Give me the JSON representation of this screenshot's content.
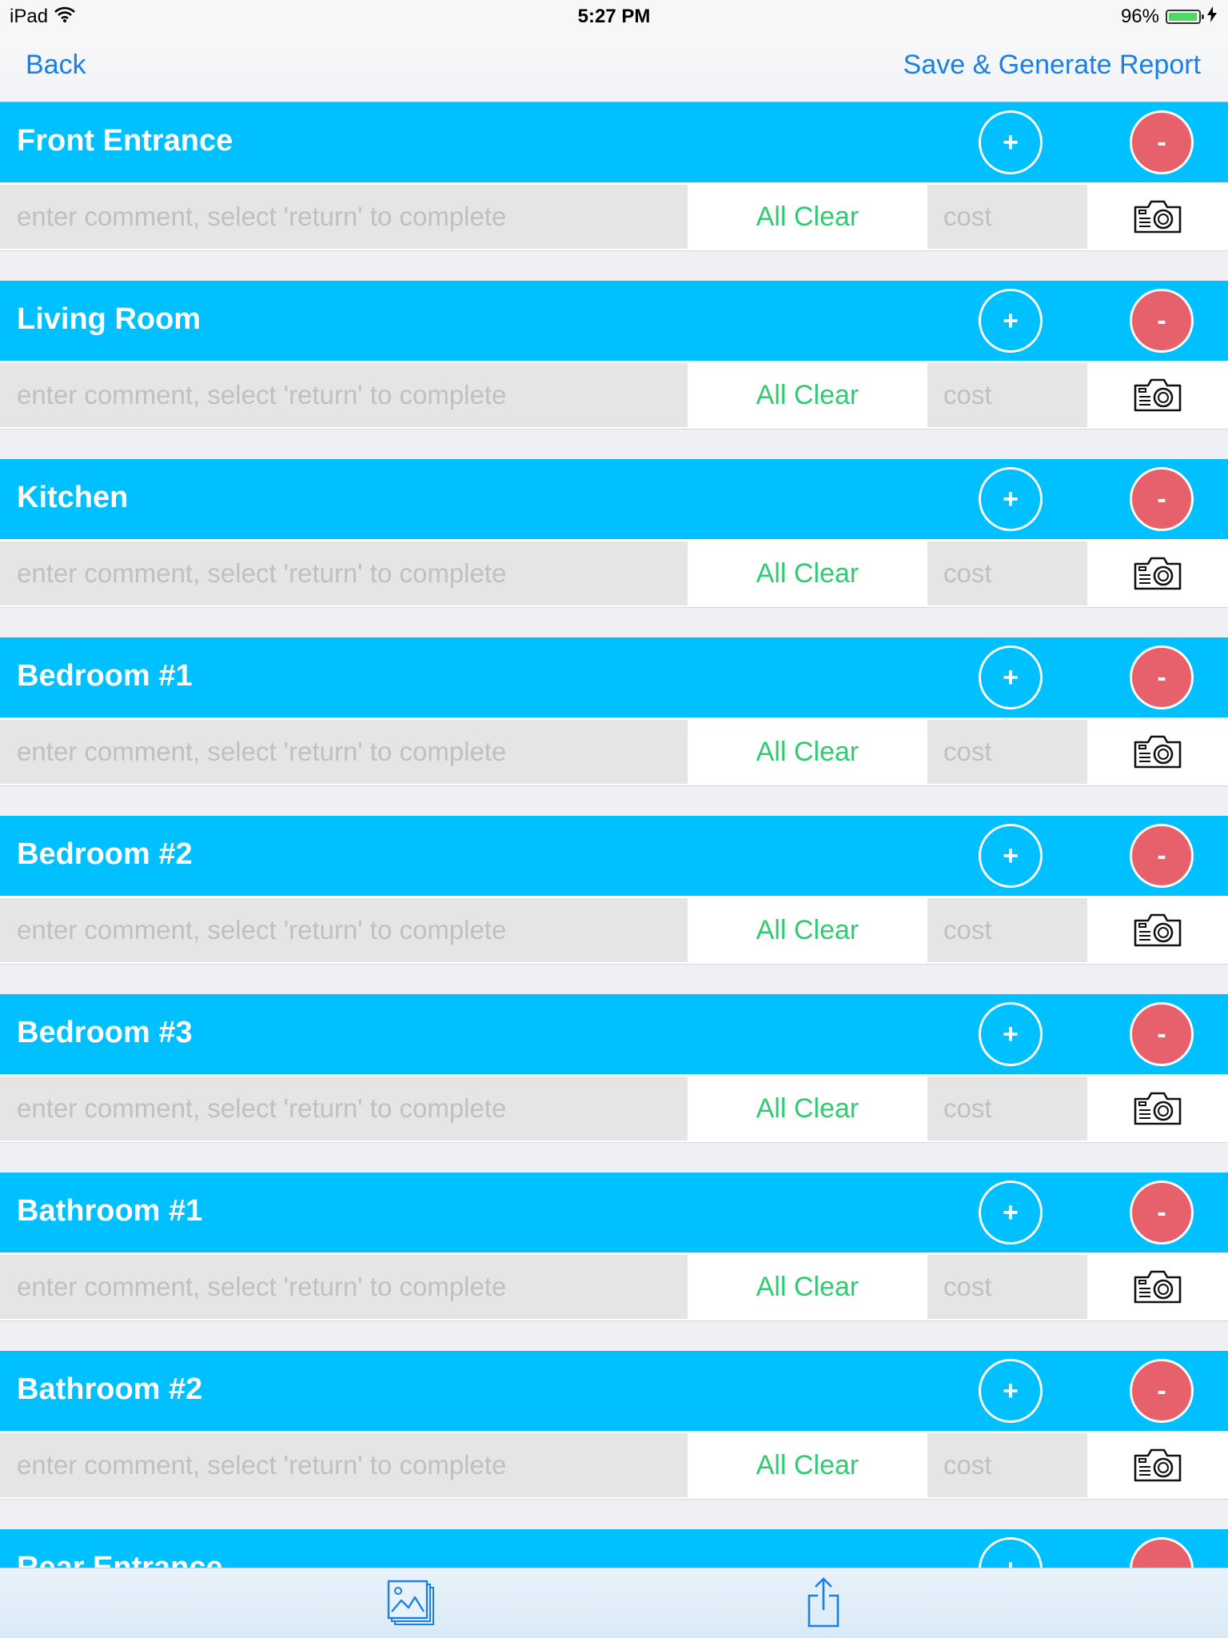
{
  "status_bar": {
    "device": "iPad",
    "time": "5:27 PM",
    "battery": "96%",
    "battery_level": 0.96
  },
  "nav": {
    "back_label": "Back",
    "action_label": "Save & Generate Report"
  },
  "row_defaults": {
    "comment_placeholder": "enter comment, select 'return' to complete",
    "all_clear_label": "All Clear",
    "cost_placeholder": "cost"
  },
  "header_buttons": {
    "add_label": "+",
    "remove_label": "-"
  },
  "rooms": [
    {
      "name": "Front Entrance"
    },
    {
      "name": "Living Room"
    },
    {
      "name": "Kitchen"
    },
    {
      "name": "Bedroom #1"
    },
    {
      "name": "Bedroom #2"
    },
    {
      "name": "Bedroom #3"
    },
    {
      "name": "Bathroom #1"
    },
    {
      "name": "Bathroom #2"
    },
    {
      "name": "Rear Entrance"
    }
  ],
  "icons": {
    "wifi": "wifi-icon",
    "battery": "battery-icon",
    "charging": "charging-bolt-icon",
    "add": "plus-icon",
    "remove": "minus-icon",
    "camera": "camera-icon",
    "gallery": "photo-gallery-icon",
    "share": "share-icon"
  },
  "colors": {
    "section_header": "#00c0ff",
    "remove_button": "#e6616b",
    "all_clear": "#2ecc71",
    "link": "#1a7fe6",
    "battery_fill": "#4cd964"
  }
}
